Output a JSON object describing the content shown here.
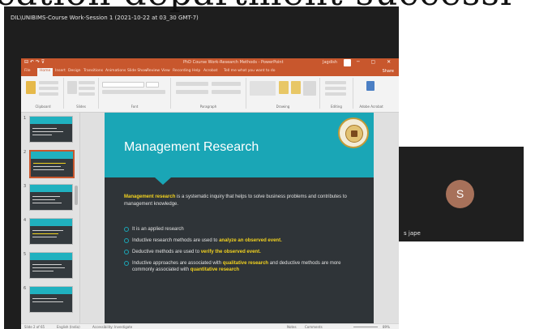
{
  "overlay_title": "cation department successi",
  "meeting": {
    "title": "DIL\\UNIBIMS-Course Work-Session 1  (2021-10-22 at 03_30 GMT-7)",
    "participant_initial": "S",
    "participant_name": "s jape"
  },
  "powerpoint": {
    "quick_access": "⊟ ↶ ↷ ⊽",
    "doc_title": "PhD Course Work-Research Methods - PowerPoint",
    "user": "Jagdish",
    "window_controls": "─ ▢ ✕",
    "tabs": [
      "File",
      "Home",
      "Insert",
      "Design",
      "Transitions",
      "Animations",
      "Slide Show",
      "Review",
      "View",
      "Recording",
      "Help",
      "Acrobat",
      "Tell me what you want to do"
    ],
    "share_label": "Share",
    "ribbon_groups": [
      "Clipboard",
      "Slides",
      "Font",
      "Paragraph",
      "Drawing",
      "Editing",
      "Adobe Acrobat"
    ],
    "slide_numbers": [
      "1",
      "2",
      "3",
      "4",
      "5",
      "6"
    ],
    "slide": {
      "title": "Management Research",
      "intro_term": "Management research",
      "intro_rest": " is a systematic inquiry that helps to solve business problems and contributes to management knowledge.",
      "bullets": [
        {
          "text": "It is an applied research",
          "hl": ""
        },
        {
          "text": "Inductive research methods are used to ",
          "hl": "analyze an observed event."
        },
        {
          "text": "Deductive methods are used to ",
          "hl": "verify the observed event."
        },
        {
          "text": "Inductive approaches are associated with ",
          "hl": "qualitative research",
          "text2": " and deductive methods are more commonly associated with ",
          "hl2": "quantitative research"
        }
      ]
    },
    "status": {
      "slide_info": "Slide 2 of 65",
      "language": "English (India)",
      "accessibility": "Accessibility: Investigate",
      "notes": "Notes",
      "comments": "Comments",
      "zoom": "89%"
    },
    "colors": {
      "accent": "#c8572d",
      "slide_teal": "#1aa6b6",
      "slide_bg": "#2f3438",
      "highlight": "#f2d21f"
    }
  }
}
